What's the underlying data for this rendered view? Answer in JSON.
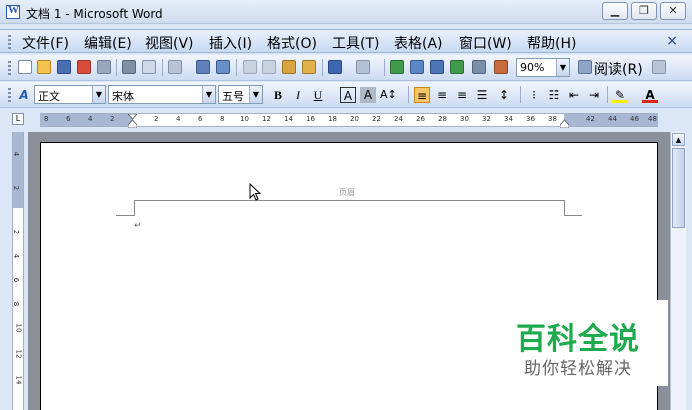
{
  "window": {
    "title": "文档 1 - Microsoft Word",
    "minimize": "▁",
    "restore": "❐",
    "close": "✕"
  },
  "menu": {
    "items": [
      "文件(F)",
      "编辑(E)",
      "视图(V)",
      "插入(I)",
      "格式(O)",
      "工具(T)",
      "表格(A)",
      "窗口(W)",
      "帮助(H)"
    ],
    "close": "×"
  },
  "standard_toolbar": {
    "zoom": "90%",
    "reading_mode": "阅读(R)"
  },
  "formatting_toolbar": {
    "style": "正文",
    "font": "宋体",
    "size": "五号",
    "bold": "B",
    "italic": "I",
    "underline": "U",
    "char_border": "A",
    "char_shading": "A"
  },
  "ruler": {
    "corner": "L",
    "ticks": [
      "8",
      "6",
      "4",
      "2",
      "2",
      "4",
      "6",
      "8",
      "10",
      "12",
      "14",
      "16",
      "18",
      "20",
      "22",
      "24",
      "26",
      "28",
      "30",
      "32",
      "34",
      "36",
      "38",
      "42",
      "44",
      "46",
      "48"
    ],
    "vertical_ticks": [
      "4",
      "2",
      "2",
      "4",
      "6",
      "8",
      "10",
      "12",
      "14"
    ]
  },
  "document": {
    "header_label": "页眉",
    "paragraph_mark": "↵"
  },
  "watermark": {
    "title": "百科全说",
    "subtitle": "助你轻松解决"
  }
}
